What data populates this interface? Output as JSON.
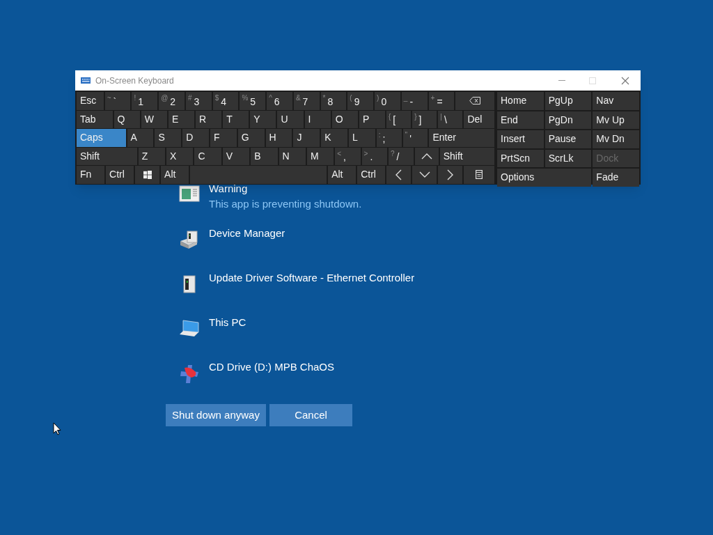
{
  "keyboard": {
    "title": "On-Screen Keyboard",
    "main_rows": [
      [
        {
          "kind": "text",
          "label": "Esc",
          "on": false
        },
        {
          "kind": "text",
          "shift": "~",
          "label": "`",
          "on": false
        },
        {
          "kind": "text",
          "shift": "!",
          "label": "1",
          "on": false
        },
        {
          "kind": "text",
          "shift": "@",
          "label": "2",
          "on": false
        },
        {
          "kind": "text",
          "shift": "#",
          "label": "3",
          "on": false
        },
        {
          "kind": "text",
          "shift": "$",
          "label": "4",
          "on": false
        },
        {
          "kind": "text",
          "shift": "%",
          "label": "5",
          "on": false
        },
        {
          "kind": "text",
          "shift": "^",
          "label": "6",
          "on": false
        },
        {
          "kind": "text",
          "shift": "&",
          "label": "7",
          "on": false
        },
        {
          "kind": "text",
          "shift": "*",
          "label": "8",
          "on": false
        },
        {
          "kind": "text",
          "shift": "(",
          "label": "9",
          "on": false
        },
        {
          "kind": "text",
          "shift": ")",
          "label": "0",
          "on": false
        },
        {
          "kind": "text",
          "shift": "_",
          "label": "-",
          "on": false
        },
        {
          "kind": "text",
          "shift": "+",
          "label": "=",
          "on": false
        },
        {
          "kind": "backspace",
          "on": false
        }
      ],
      [
        {
          "kind": "text",
          "label": "Tab",
          "on": false
        },
        {
          "kind": "text",
          "label": "Q",
          "on": false
        },
        {
          "kind": "text",
          "label": "W",
          "on": false
        },
        {
          "kind": "text",
          "label": "E",
          "on": false
        },
        {
          "kind": "text",
          "label": "R",
          "on": false
        },
        {
          "kind": "text",
          "label": "T",
          "on": false
        },
        {
          "kind": "text",
          "label": "Y",
          "on": false
        },
        {
          "kind": "text",
          "label": "U",
          "on": false
        },
        {
          "kind": "text",
          "label": "I",
          "on": false
        },
        {
          "kind": "text",
          "label": "O",
          "on": false
        },
        {
          "kind": "text",
          "label": "P",
          "on": false
        },
        {
          "kind": "text",
          "shift": "{",
          "label": "[",
          "on": false
        },
        {
          "kind": "text",
          "shift": "}",
          "label": "]",
          "on": false
        },
        {
          "kind": "text",
          "shift": "|",
          "label": "\\",
          "on": false
        },
        {
          "kind": "text",
          "label": "Del",
          "on": false
        }
      ],
      [
        {
          "kind": "text",
          "label": "Caps",
          "on": true
        },
        {
          "kind": "text",
          "label": "A",
          "on": false
        },
        {
          "kind": "text",
          "label": "S",
          "on": false
        },
        {
          "kind": "text",
          "label": "D",
          "on": false
        },
        {
          "kind": "text",
          "label": "F",
          "on": false
        },
        {
          "kind": "text",
          "label": "G",
          "on": false
        },
        {
          "kind": "text",
          "label": "H",
          "on": false
        },
        {
          "kind": "text",
          "label": "J",
          "on": false
        },
        {
          "kind": "text",
          "label": "K",
          "on": false
        },
        {
          "kind": "text",
          "label": "L",
          "on": false
        },
        {
          "kind": "text",
          "shift": ":",
          "label": ";",
          "on": false
        },
        {
          "kind": "text",
          "shift": "\"",
          "label": "'",
          "on": false
        },
        {
          "kind": "text",
          "label": "Enter",
          "on": false
        }
      ],
      [
        {
          "kind": "text",
          "label": "Shift",
          "on": false
        },
        {
          "kind": "text",
          "label": "Z",
          "on": false
        },
        {
          "kind": "text",
          "label": "X",
          "on": false
        },
        {
          "kind": "text",
          "label": "C",
          "on": false
        },
        {
          "kind": "text",
          "label": "V",
          "on": false
        },
        {
          "kind": "text",
          "label": "B",
          "on": false
        },
        {
          "kind": "text",
          "label": "N",
          "on": false
        },
        {
          "kind": "text",
          "label": "M",
          "on": false
        },
        {
          "kind": "text",
          "shift": "<",
          "label": ",",
          "on": false
        },
        {
          "kind": "text",
          "shift": ">",
          "label": ".",
          "on": false
        },
        {
          "kind": "text",
          "shift": "?",
          "label": "/",
          "on": false
        },
        {
          "kind": "up",
          "on": false
        },
        {
          "kind": "text",
          "label": "Shift",
          "on": false
        }
      ],
      [
        {
          "kind": "text",
          "label": "Fn",
          "on": false
        },
        {
          "kind": "text",
          "label": "Ctrl",
          "on": false
        },
        {
          "kind": "windows",
          "on": false
        },
        {
          "kind": "text",
          "label": "Alt",
          "on": false
        },
        {
          "kind": "space",
          "on": false
        },
        {
          "kind": "text",
          "label": "Alt",
          "on": false
        },
        {
          "kind": "text",
          "label": "Ctrl",
          "on": false
        },
        {
          "kind": "left",
          "on": false
        },
        {
          "kind": "down",
          "on": false
        },
        {
          "kind": "right",
          "on": false
        },
        {
          "kind": "menu",
          "on": false
        }
      ]
    ],
    "side_rows": [
      [
        {
          "label": "Home",
          "disabled": false
        },
        {
          "label": "PgUp",
          "disabled": false
        },
        {
          "label": "Nav",
          "disabled": false
        }
      ],
      [
        {
          "label": "End",
          "disabled": false
        },
        {
          "label": "PgDn",
          "disabled": false
        },
        {
          "label": "Mv Up",
          "disabled": false
        }
      ],
      [
        {
          "label": "Insert",
          "disabled": false
        },
        {
          "label": "Pause",
          "disabled": false
        },
        {
          "label": "Mv Dn",
          "disabled": false
        }
      ],
      [
        {
          "label": "PrtScn",
          "disabled": false
        },
        {
          "label": "ScrLk",
          "disabled": false
        },
        {
          "label": "Dock",
          "disabled": true
        }
      ],
      [
        {
          "label": "Options",
          "disabled": false
        },
        {
          "label": "Fade",
          "disabled": false
        }
      ]
    ]
  },
  "apps": [
    {
      "kind": "window",
      "name": "Warning",
      "detail": "This app is preventing shutdown."
    },
    {
      "kind": "device-manager",
      "name": "Device Manager"
    },
    {
      "kind": "tower",
      "name": "Update Driver Software - Ethernet Controller"
    },
    {
      "kind": "laptop",
      "name": "This PC"
    },
    {
      "kind": "disc",
      "name": "CD Drive (D:) MPB ChaOS"
    }
  ],
  "buttons": [
    "Shut down anyway",
    "Cancel"
  ]
}
